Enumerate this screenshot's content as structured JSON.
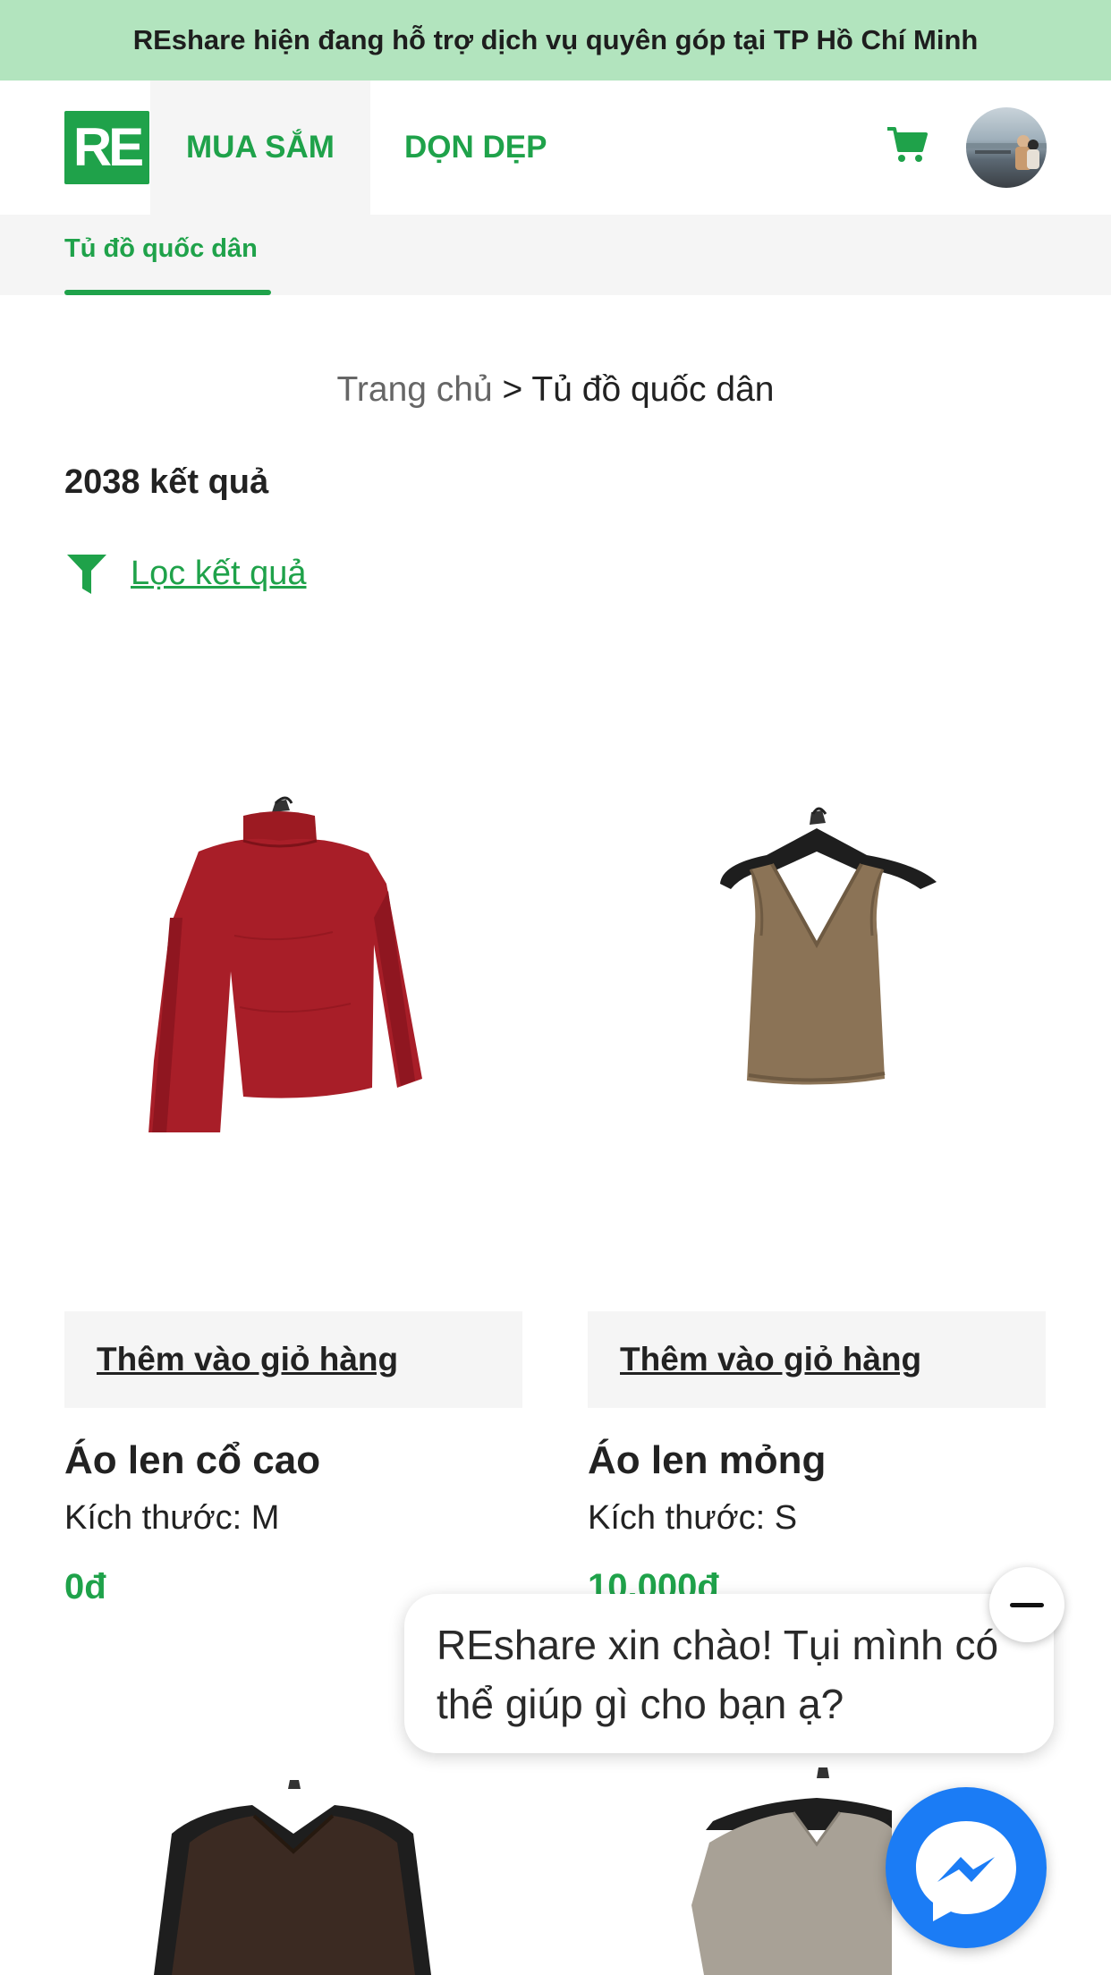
{
  "banner": {
    "text": "REshare hiện đang hỗ trợ dịch vụ quyên góp tại TP Hồ Chí Minh"
  },
  "header": {
    "logo_text": "RE",
    "nav_shop": "MUA SẮM",
    "nav_clean": "DỌN DẸP",
    "cart_icon": "cart-icon",
    "avatar_icon": "avatar"
  },
  "subnav": {
    "active_item": "Tủ đồ quốc dân"
  },
  "breadcrumb": {
    "home": "Trang chủ",
    "separator": " > ",
    "current": "Tủ đồ quốc dân"
  },
  "results": {
    "count_text": "2038 kết quả",
    "filter_label": "Lọc kết quả",
    "filter_icon": "funnel-icon"
  },
  "products": [
    {
      "add_to_cart": "Thêm vào giỏ hàng",
      "name": "Áo len cổ cao",
      "size": "Kích thước: M",
      "price": "0đ",
      "image": "red-turtleneck-sweater"
    },
    {
      "add_to_cart": "Thêm vào giỏ hàng",
      "name": "Áo len mỏng",
      "size": "Kích thước: S",
      "price": "10.000đ",
      "image": "brown-knit-tank-top"
    }
  ],
  "chat": {
    "greeting": "REshare xin chào! Tụi mình có thể giúp gì cho bạn ạ?",
    "close_icon": "minimize-icon",
    "launcher_icon": "messenger-icon"
  },
  "colors": {
    "brand_green": "#1fa24a",
    "banner_bg": "#b2e4be",
    "messenger_blue": "#1b7cf5"
  }
}
